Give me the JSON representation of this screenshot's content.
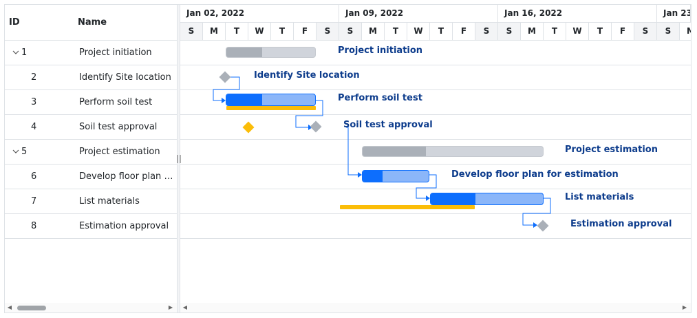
{
  "grid": {
    "headers": {
      "id": "ID",
      "name": "Name"
    },
    "rows": [
      {
        "id": "1",
        "name": "Project initiation",
        "expandable": true
      },
      {
        "id": "2",
        "name": "Identify Site location",
        "expandable": false
      },
      {
        "id": "3",
        "name": "Perform soil test",
        "expandable": false
      },
      {
        "id": "4",
        "name": "Soil test approval",
        "expandable": false
      },
      {
        "id": "5",
        "name": "Project estimation",
        "expandable": true
      },
      {
        "id": "6",
        "name": "Develop floor plan f...",
        "expandable": false
      },
      {
        "id": "7",
        "name": "List materials",
        "expandable": false
      },
      {
        "id": "8",
        "name": "Estimation approval",
        "expandable": false
      }
    ]
  },
  "timeline": {
    "weeks": [
      "Jan 02, 2022",
      "Jan 09, 2022",
      "Jan 16, 2022",
      "Jan 23"
    ],
    "days": [
      "S",
      "M",
      "T",
      "W",
      "T",
      "F",
      "S",
      "S",
      "M",
      "T",
      "W",
      "T",
      "F",
      "S",
      "S",
      "M",
      "T",
      "W",
      "T",
      "F",
      "S",
      "S",
      "M"
    ]
  },
  "tasks": [
    {
      "label": "Project initiation",
      "type": "parent",
      "progress": 0.4
    },
    {
      "label": "Identify Site location",
      "type": "milestone"
    },
    {
      "label": "Perform soil test",
      "type": "task",
      "progress": 0.4
    },
    {
      "label": "Soil test approval",
      "type": "milestone"
    },
    {
      "label": "Project estimation",
      "type": "parent",
      "progress": 0.35
    },
    {
      "label": "Develop floor plan for estimation",
      "type": "task",
      "progress": 0.3
    },
    {
      "label": "List materials",
      "type": "task",
      "progress": 0.4
    },
    {
      "label": "Estimation approval",
      "type": "milestone"
    }
  ],
  "colors": {
    "progress": "#0d6efd",
    "task_fill": "#8bb6f9",
    "parent_fill": "#d0d4db",
    "parent_progress": "#aab0b8",
    "baseline": "#fbbd08",
    "label": "#0d3c8c",
    "connector": "#0d6efd"
  },
  "icons": {
    "expand": "chevron-down-icon",
    "splitter": "resize-grip-icon",
    "scroll_left": "caret-left-icon",
    "scroll_right": "caret-right-icon"
  }
}
